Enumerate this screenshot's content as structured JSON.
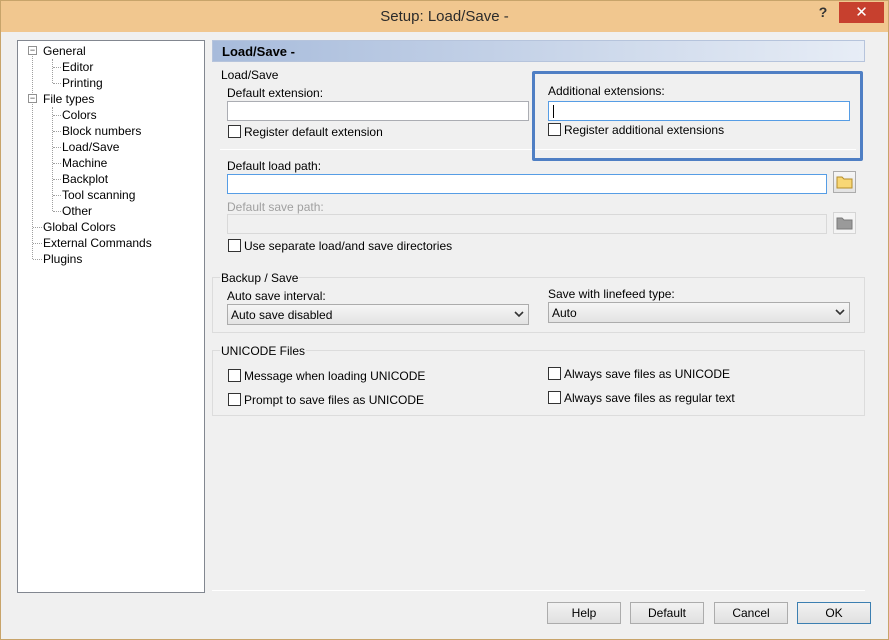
{
  "window": {
    "title": "Setup: Load/Save -",
    "help_glyph": "?",
    "close_glyph": "✕"
  },
  "tree": {
    "items": [
      {
        "label": "General",
        "expander": "−"
      },
      {
        "label": "Editor"
      },
      {
        "label": "Printing"
      },
      {
        "label": "File types",
        "expander": "−"
      },
      {
        "label": "Colors"
      },
      {
        "label": "Block numbers"
      },
      {
        "label": "Load/Save"
      },
      {
        "label": "Machine"
      },
      {
        "label": "Backplot"
      },
      {
        "label": "Tool scanning"
      },
      {
        "label": "Other"
      },
      {
        "label": "Global Colors"
      },
      {
        "label": "External Commands"
      },
      {
        "label": "Plugins"
      }
    ]
  },
  "page": {
    "header": "Load/Save -"
  },
  "load_save": {
    "group_label": "Load/Save",
    "default_ext_label": "Default extension:",
    "default_ext_value": "",
    "register_default_label": "Register default extension",
    "additional_ext_label": "Additional extensions:",
    "additional_ext_value": "",
    "register_additional_label": "Register additional extensions",
    "default_load_path_label": "Default load path:",
    "default_load_path_value": "",
    "default_save_path_label": "Default save path:",
    "default_save_path_value": "",
    "separate_dirs_label": "Use separate load/and save directories"
  },
  "backup": {
    "group_label": "Backup / Save",
    "auto_save_label": "Auto save interval:",
    "auto_save_value": "Auto save disabled",
    "linefeed_label": "Save with linefeed type:",
    "linefeed_value": "Auto"
  },
  "unicode": {
    "group_label": "UNICODE Files",
    "msg_loading_label": "Message when loading UNICODE",
    "prompt_save_label": "Prompt to save files as UNICODE",
    "always_unicode_label": "Always save files as UNICODE",
    "always_regular_label": "Always save files as regular text"
  },
  "buttons": {
    "help": "Help",
    "default": "Default",
    "cancel": "Cancel",
    "ok": "OK"
  },
  "icons": {
    "folder": "folder-icon",
    "dropdown": "chevron-down-icon"
  },
  "colors": {
    "titlebar": "#f1c78f",
    "close": "#c7402e",
    "highlight": "#4f7fc4",
    "folder_fill": "#f8d775"
  }
}
